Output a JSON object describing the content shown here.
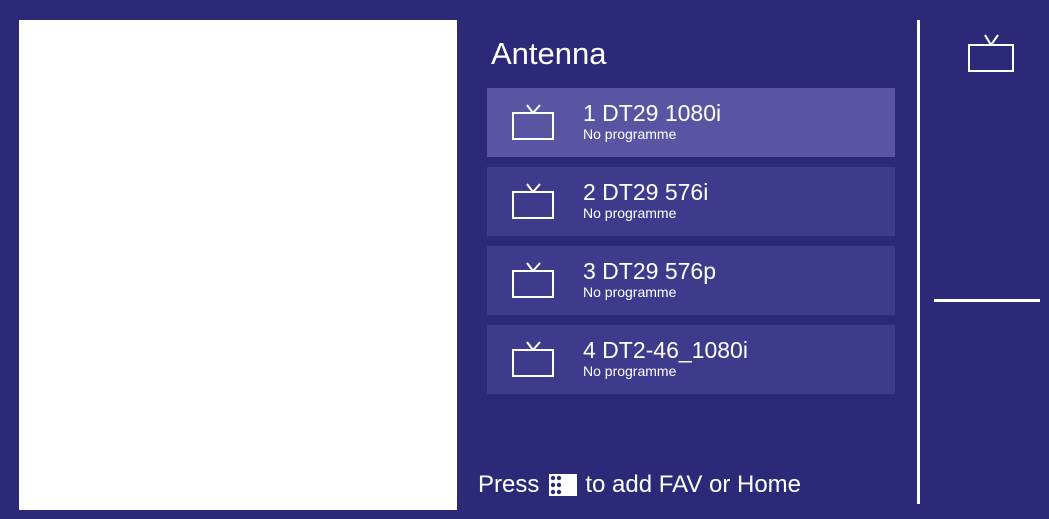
{
  "source": {
    "title": "Antenna"
  },
  "channels": [
    {
      "name": "1 DT29 1080i",
      "subtitle": "No programme",
      "selected": true,
      "icon": "tv-icon"
    },
    {
      "name": "2 DT29 576i",
      "subtitle": "No programme",
      "selected": false,
      "icon": "tv-icon"
    },
    {
      "name": "3 DT29 576p",
      "subtitle": "No programme",
      "selected": false,
      "icon": "tv-icon"
    },
    {
      "name": "4 DT2-46_1080i",
      "subtitle": "No programme",
      "selected": false,
      "icon": "tv-icon"
    }
  ],
  "hint": {
    "prefix": "Press",
    "icon": "options-dots-icon",
    "suffix": "to add FAV or Home"
  },
  "side": {
    "icon": "tv-icon"
  },
  "colors": {
    "background": "#2c2a78",
    "row": "#3e3a8c",
    "row_selected": "#5a55a2",
    "preview": "#ffffff",
    "text": "#ffffff"
  }
}
